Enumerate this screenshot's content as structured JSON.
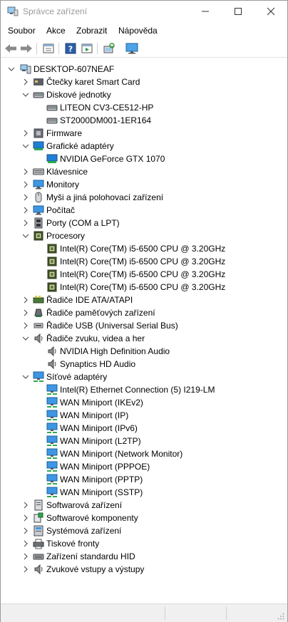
{
  "window": {
    "title": "Správce zařízení",
    "colors": {
      "accent": "#1f6fc4",
      "chevron": "#555555",
      "title_text": "#9a9a9a"
    }
  },
  "menu": [
    "Soubor",
    "Akce",
    "Zobrazit",
    "Nápověda"
  ],
  "toolbar": [
    "back-arrow-icon",
    "forward-arrow-icon",
    "properties-icon",
    "help-icon",
    "run-icon",
    "scan-hardware-icon",
    "monitor-icon"
  ],
  "tree": [
    {
      "label": "DESKTOP-607NEAF",
      "level": 0,
      "expander": "open",
      "icon": "computer"
    },
    {
      "label": "Čtečky karet Smart Card",
      "level": 1,
      "expander": "closed",
      "icon": "smartcard"
    },
    {
      "label": "Diskové jednotky",
      "level": 1,
      "expander": "open",
      "icon": "disk"
    },
    {
      "label": "LITEON CV3-CE512-HP",
      "level": 2,
      "expander": "none",
      "icon": "disk"
    },
    {
      "label": "ST2000DM001-1ER164",
      "level": 2,
      "expander": "none",
      "icon": "disk"
    },
    {
      "label": "Firmware",
      "level": 1,
      "expander": "closed",
      "icon": "firmware"
    },
    {
      "label": "Grafické adaptéry",
      "level": 1,
      "expander": "open",
      "icon": "display"
    },
    {
      "label": "NVIDIA GeForce GTX 1070",
      "level": 2,
      "expander": "none",
      "icon": "display"
    },
    {
      "label": "Klávesnice",
      "level": 1,
      "expander": "closed",
      "icon": "keyboard"
    },
    {
      "label": "Monitory",
      "level": 1,
      "expander": "closed",
      "icon": "monitor"
    },
    {
      "label": "Myši a jiná polohovací zařízení",
      "level": 1,
      "expander": "closed",
      "icon": "mouse"
    },
    {
      "label": "Počítač",
      "level": 1,
      "expander": "closed",
      "icon": "monitor"
    },
    {
      "label": "Porty (COM a LPT)",
      "level": 1,
      "expander": "closed",
      "icon": "port"
    },
    {
      "label": "Procesory",
      "level": 1,
      "expander": "open",
      "icon": "cpu"
    },
    {
      "label": "Intel(R) Core(TM) i5-6500 CPU @ 3.20GHz",
      "level": 2,
      "expander": "none",
      "icon": "cpu"
    },
    {
      "label": "Intel(R) Core(TM) i5-6500 CPU @ 3.20GHz",
      "level": 2,
      "expander": "none",
      "icon": "cpu"
    },
    {
      "label": "Intel(R) Core(TM) i5-6500 CPU @ 3.20GHz",
      "level": 2,
      "expander": "none",
      "icon": "cpu"
    },
    {
      "label": "Intel(R) Core(TM) i5-6500 CPU @ 3.20GHz",
      "level": 2,
      "expander": "none",
      "icon": "cpu"
    },
    {
      "label": "Řadiče IDE ATA/ATAPI",
      "level": 1,
      "expander": "closed",
      "icon": "controller"
    },
    {
      "label": "Řadiče paměťových zařízení",
      "level": 1,
      "expander": "closed",
      "icon": "storage"
    },
    {
      "label": "Řadiče USB (Universal Serial Bus)",
      "level": 1,
      "expander": "closed",
      "icon": "usb"
    },
    {
      "label": "Řadiče zvuku, videa a her",
      "level": 1,
      "expander": "open",
      "icon": "speaker"
    },
    {
      "label": "NVIDIA High Definition Audio",
      "level": 2,
      "expander": "none",
      "icon": "speaker"
    },
    {
      "label": "Synaptics HD Audio",
      "level": 2,
      "expander": "none",
      "icon": "speaker"
    },
    {
      "label": "Síťové adaptéry",
      "level": 1,
      "expander": "open",
      "icon": "network"
    },
    {
      "label": "Intel(R) Ethernet Connection (5) I219-LM",
      "level": 2,
      "expander": "none",
      "icon": "network"
    },
    {
      "label": "WAN Miniport (IKEv2)",
      "level": 2,
      "expander": "none",
      "icon": "network"
    },
    {
      "label": "WAN Miniport (IP)",
      "level": 2,
      "expander": "none",
      "icon": "network"
    },
    {
      "label": "WAN Miniport (IPv6)",
      "level": 2,
      "expander": "none",
      "icon": "network"
    },
    {
      "label": "WAN Miniport (L2TP)",
      "level": 2,
      "expander": "none",
      "icon": "network"
    },
    {
      "label": "WAN Miniport (Network Monitor)",
      "level": 2,
      "expander": "none",
      "icon": "network"
    },
    {
      "label": "WAN Miniport (PPPOE)",
      "level": 2,
      "expander": "none",
      "icon": "network"
    },
    {
      "label": "WAN Miniport (PPTP)",
      "level": 2,
      "expander": "none",
      "icon": "network"
    },
    {
      "label": "WAN Miniport (SSTP)",
      "level": 2,
      "expander": "none",
      "icon": "network"
    },
    {
      "label": "Softwarová zařízení",
      "level": 1,
      "expander": "closed",
      "icon": "software"
    },
    {
      "label": "Softwarové komponenty",
      "level": 1,
      "expander": "closed",
      "icon": "component"
    },
    {
      "label": "Systémová zařízení",
      "level": 1,
      "expander": "closed",
      "icon": "system"
    },
    {
      "label": "Tiskové fronty",
      "level": 1,
      "expander": "closed",
      "icon": "printer"
    },
    {
      "label": "Zařízení standardu HID",
      "level": 1,
      "expander": "closed",
      "icon": "hid"
    },
    {
      "label": "Zvukové vstupy a výstupy",
      "level": 1,
      "expander": "closed",
      "icon": "speaker"
    }
  ]
}
